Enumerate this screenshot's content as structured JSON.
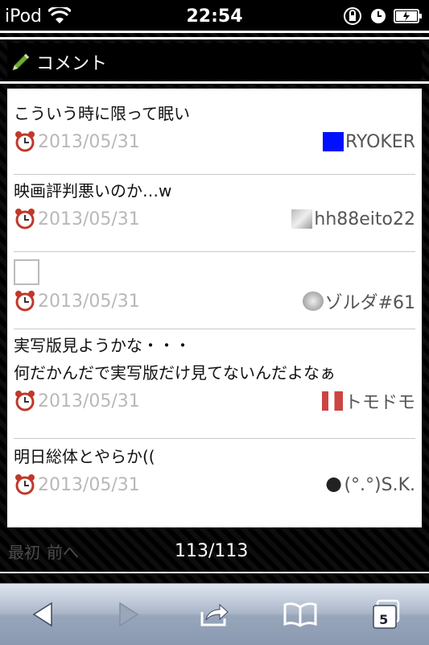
{
  "status_bar": {
    "carrier": "iPod",
    "time": "22:54"
  },
  "section": {
    "title": "コメント"
  },
  "comments": [
    {
      "lines": [
        "こういう時に限って眠い"
      ],
      "date": "2013/05/31",
      "author": "RYOKER"
    },
    {
      "lines": [
        "映画評判悪いのか…w"
      ],
      "date": "2013/05/31",
      "author": "hh88eito22"
    },
    {
      "lines": [],
      "date": "2013/05/31",
      "author": "ゾルダ#61"
    },
    {
      "lines": [
        "実写版見ようかな・・・",
        "何だかんだで実写版だけ見てないんだよなぁ"
      ],
      "date": "2013/05/31",
      "author": "トモドモ"
    },
    {
      "lines": [
        "明日総体とやらか(("
      ],
      "date": "2013/05/31",
      "author": "(°.°)S.K."
    }
  ],
  "pager": {
    "first": "最初",
    "prev": "前へ",
    "count": "113/113"
  },
  "toolbar": {
    "tabs_count": "5"
  },
  "colors": {
    "accent": "#0000ff",
    "date_gray": "#b8b8b8"
  }
}
